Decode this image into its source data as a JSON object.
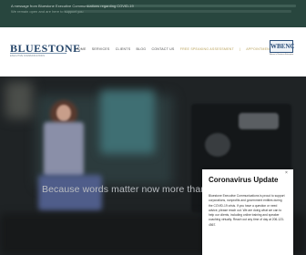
{
  "topbar": {
    "notice": "A message from Bluestone Executive Communications regarding COVID-19",
    "subnotice": "We remain open and are here to support you"
  },
  "header": {
    "logo": "BLUESTONE",
    "tagline": "EXECUTIVE COMMUNICATIONS",
    "nav": [
      "HOME",
      "SERVICES",
      "CLIENTS",
      "BLOG",
      "CONTACT US"
    ],
    "cta_primary": "FREE SPEAKING ASSESSMENT",
    "cta_divider": "|",
    "cta_secondary": "APPOINTMENTS",
    "badge": "WBENC",
    "badge_caption": "Women's Business Enterprise"
  },
  "hero": {
    "tagline": "Because words matter now more than ever."
  },
  "popup": {
    "close": "×",
    "title": "Coronavirus Update",
    "body": "Bluestone Executive Communications is proud to support corporations, nonprofits and government entities during the COVID-19 crisis. If you have a question or need advice, please reach out. We are doing what we can to help our clients, including online training and speaker coaching virtually. Reach out any time of day at 206-123-4567."
  },
  "colors": {
    "topbar": "#28463e",
    "logo": "#27476b",
    "nav_cta": "#b9a25a",
    "hero_bg": "#1f2325",
    "popup_bg": "#ffffff"
  }
}
